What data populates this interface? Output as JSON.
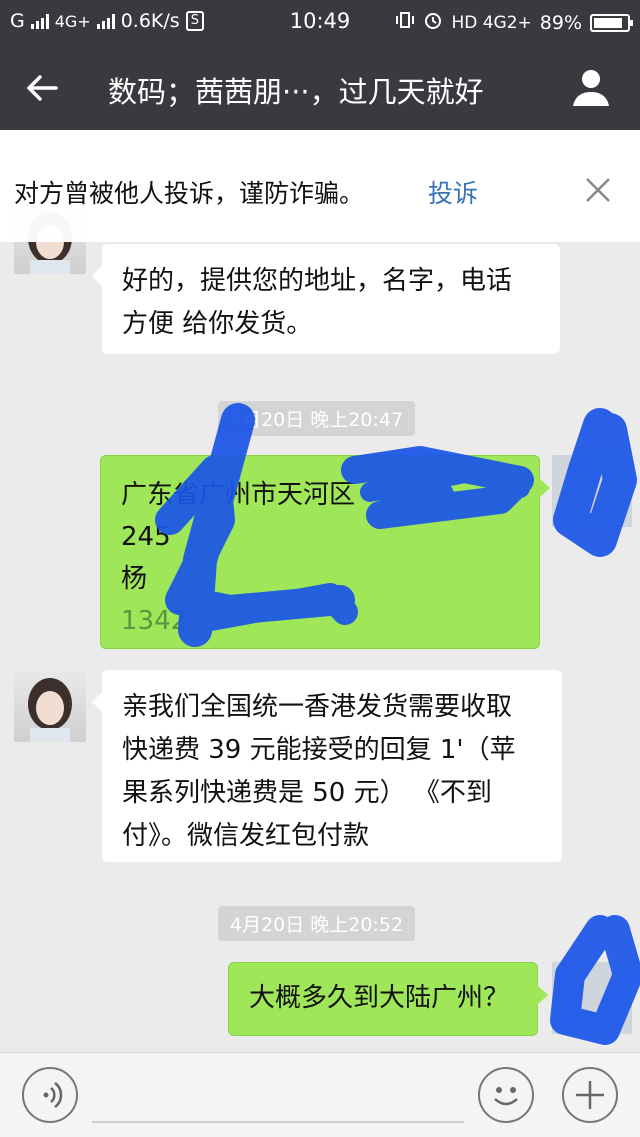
{
  "status_bar": {
    "carrier": "G",
    "network_left": "4G+",
    "speed": "0.6K/s",
    "sim_badge": "S",
    "time": "10:49",
    "network_right": "HD 4G2+",
    "battery_percent": "89%",
    "battery_level": 0.89
  },
  "header": {
    "back_icon": "arrow-left-icon",
    "title": "数码；茜茜朋···，过几天就好",
    "profile_icon": "person-icon"
  },
  "warning": {
    "text": "对方曾被他人投诉，谨防诈骗。",
    "link": "投诉",
    "close_icon": "close-icon"
  },
  "messages": [
    {
      "side": "left",
      "lines": [
        "好的，提供您的地址，名字，电话",
        "方便 给你发货。"
      ]
    },
    {
      "type": "timestamp",
      "text": "4月20日 晚上20:47"
    },
    {
      "side": "right",
      "lines": [
        "广东省广州市天河区",
        "245",
        "杨",
        "1342"
      ],
      "redacted": true
    },
    {
      "side": "left",
      "lines": [
        "亲我们全国统一香港发货需要收取",
        "快递费 39 元能接受的回复 1'（苹",
        "果系列快递费是 50 元）  《不到",
        "付》。微信发红包付款"
      ]
    },
    {
      "type": "timestamp",
      "text": "4月20日 晚上20:52"
    },
    {
      "side": "right",
      "lines": [
        "大概多久到大陆广州？"
      ]
    }
  ],
  "input_bar": {
    "voice_icon": "voice-icon",
    "emoji_icon": "emoji-icon",
    "plus_icon": "plus-icon"
  },
  "colors": {
    "header_bg": "#393a3f",
    "chat_bg": "#ebebeb",
    "sent_bubble": "#9fe658",
    "scribble": "#1a55e8",
    "link": "#3a73b8"
  }
}
